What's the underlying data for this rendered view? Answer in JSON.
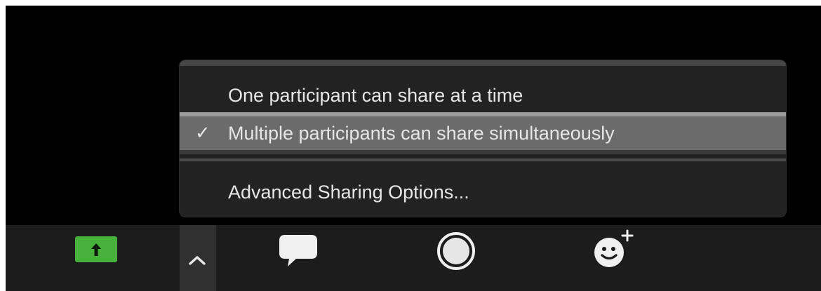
{
  "share_menu": {
    "items": [
      {
        "label": "One participant can share at a time",
        "checked": false
      },
      {
        "label": "Multiple participants can share simultaneously",
        "checked": true
      },
      {
        "label": "Advanced Sharing Options...",
        "checked": false
      }
    ],
    "checkmark_glyph": "✓",
    "highlight_color": "#6b6b6b"
  },
  "toolbar": {
    "buttons": [
      {
        "name": "share-screen-button",
        "icon": "up-arrow-icon",
        "color": "#47b23b"
      },
      {
        "name": "share-options-caret",
        "icon": "chevron-up-icon"
      },
      {
        "name": "chat-button",
        "icon": "chat-bubble-icon"
      },
      {
        "name": "record-button",
        "icon": "record-circle-icon"
      },
      {
        "name": "reactions-button",
        "icon": "add-reaction-icon"
      }
    ]
  }
}
